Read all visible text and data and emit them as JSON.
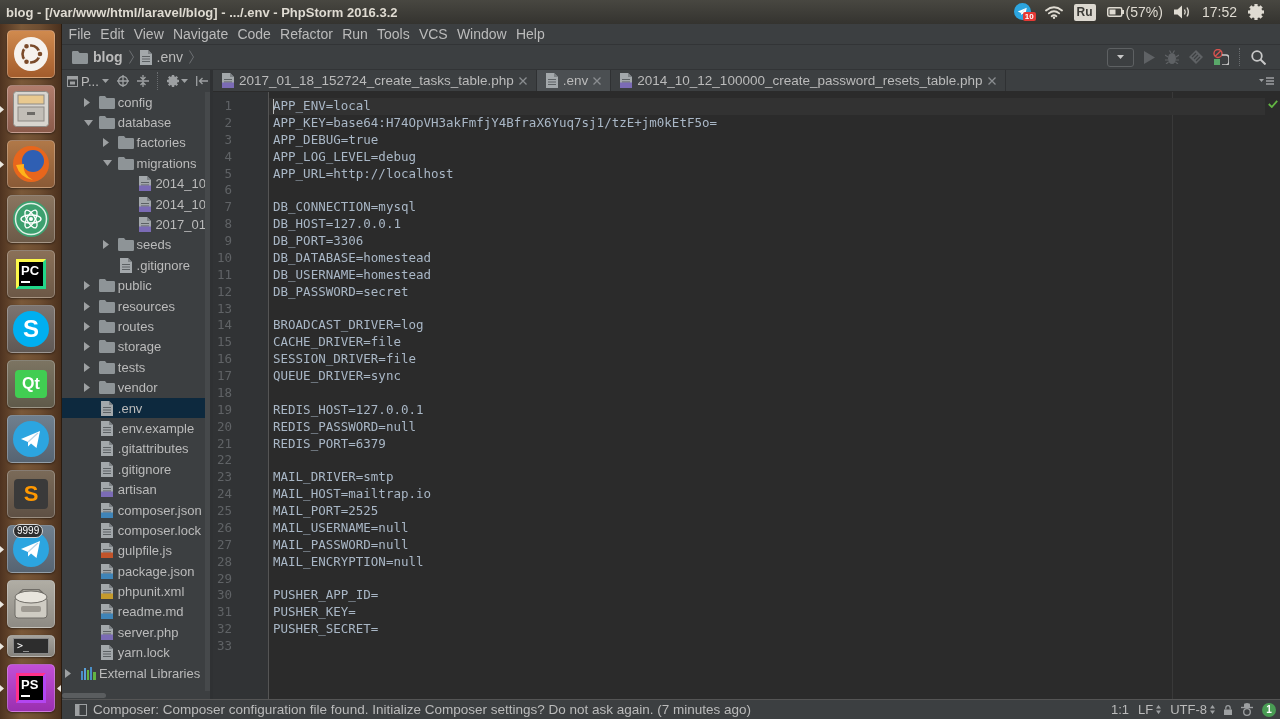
{
  "top_panel": {
    "title": "blog - [/var/www/html/laravel/blog] - .../.env - PhpStorm 2016.3.2",
    "notification_badge": "10",
    "keyboard_layout": "Ru",
    "battery": "(57%)",
    "clock": "17:52"
  },
  "launcher": {
    "items": [
      {
        "kind": "ubuntu",
        "running": false,
        "focused": false
      },
      {
        "kind": "files",
        "running": true,
        "focused": false
      },
      {
        "kind": "firefox",
        "running": true,
        "focused": false
      },
      {
        "kind": "atom",
        "running": false,
        "focused": false
      },
      {
        "kind": "pycharm",
        "glyph": "PC",
        "running": false,
        "focused": false
      },
      {
        "kind": "skype",
        "glyph": "S",
        "running": false,
        "focused": false
      },
      {
        "kind": "qt",
        "glyph": "Qt",
        "running": false,
        "focused": false
      },
      {
        "kind": "telegram",
        "running": false,
        "focused": false
      },
      {
        "kind": "sublime",
        "glyph": "S",
        "running": false,
        "focused": false
      },
      {
        "kind": "telegram",
        "badge": "9999",
        "running": true,
        "focused": false
      },
      {
        "kind": "scanner",
        "running": true,
        "focused": false
      },
      {
        "kind": "terminal",
        "glyph": ">_",
        "running": true,
        "focused": false
      },
      {
        "kind": "phpstorm",
        "glyph": "PS",
        "running": true,
        "focused": true
      }
    ]
  },
  "menu_bar": {
    "items": [
      "File",
      "Edit",
      "View",
      "Navigate",
      "Code",
      "Refactor",
      "Run",
      "Tools",
      "VCS",
      "Window",
      "Help"
    ]
  },
  "navigation_bar": {
    "crumbs": [
      {
        "kind": "folder",
        "label": "blog"
      },
      {
        "kind": "file",
        "label": ".env"
      }
    ]
  },
  "project_panel": {
    "title": "P...",
    "tree": [
      {
        "kind": "folder",
        "label": "config",
        "expanded": false,
        "selected": false
      },
      {
        "kind": "folder",
        "label": "database",
        "expanded": true,
        "selected": false,
        "children": [
          {
            "kind": "folder",
            "label": "factories",
            "expanded": false,
            "selected": false
          },
          {
            "kind": "folder",
            "label": "migrations",
            "expanded": true,
            "selected": false,
            "children": [
              {
                "kind": "php",
                "label": "2014_10",
                "selected": false
              },
              {
                "kind": "php",
                "label": "2014_10",
                "selected": false
              },
              {
                "kind": "php",
                "label": "2017_01",
                "selected": false
              }
            ]
          },
          {
            "kind": "folder",
            "label": "seeds",
            "expanded": false,
            "selected": false
          },
          {
            "kind": "text",
            "label": ".gitignore",
            "selected": false
          }
        ]
      },
      {
        "kind": "folder",
        "label": "public",
        "expanded": false,
        "selected": false
      },
      {
        "kind": "folder",
        "label": "resources",
        "expanded": false,
        "selected": false
      },
      {
        "kind": "folder",
        "label": "routes",
        "expanded": false,
        "selected": false
      },
      {
        "kind": "folder",
        "label": "storage",
        "expanded": false,
        "selected": false
      },
      {
        "kind": "folder",
        "label": "tests",
        "expanded": false,
        "selected": false
      },
      {
        "kind": "folder",
        "label": "vendor",
        "expanded": false,
        "selected": false
      },
      {
        "kind": "text",
        "label": ".env",
        "selected": true
      },
      {
        "kind": "text",
        "label": ".env.example",
        "selected": false
      },
      {
        "kind": "text",
        "label": ".gitattributes",
        "selected": false
      },
      {
        "kind": "text",
        "label": ".gitignore",
        "selected": false
      },
      {
        "kind": "php",
        "label": "artisan",
        "selected": false
      },
      {
        "kind": "json",
        "label": "composer.json",
        "selected": false
      },
      {
        "kind": "text",
        "label": "composer.lock",
        "selected": false
      },
      {
        "kind": "js",
        "label": "gulpfile.js",
        "selected": false
      },
      {
        "kind": "json",
        "label": "package.json",
        "selected": false
      },
      {
        "kind": "xml",
        "label": "phpunit.xml",
        "selected": false
      },
      {
        "kind": "md",
        "label": "readme.md",
        "selected": false
      },
      {
        "kind": "php",
        "label": "server.php",
        "selected": false
      },
      {
        "kind": "text",
        "label": "yarn.lock",
        "selected": false
      }
    ],
    "external_libraries": {
      "kind": "library",
      "label": "External Libraries",
      "expanded": false,
      "selected": false
    }
  },
  "editor": {
    "tabs": [
      {
        "kind": "php",
        "label": "2017_01_18_152724_create_tasks_table.php",
        "selected": false
      },
      {
        "kind": "text",
        "label": ".env",
        "selected": true
      },
      {
        "kind": "php",
        "label": "2014_10_12_100000_create_password_resets_table.php",
        "selected": false
      }
    ],
    "lines": [
      {
        "number": "1",
        "text": "APP_ENV=local",
        "current": true
      },
      {
        "number": "2",
        "text": "APP_KEY=base64:H74OpVH3akFmfjY4BfraX6Yuq7sj1/tzE+jm0kEtF5o=",
        "current": false
      },
      {
        "number": "3",
        "text": "APP_DEBUG=true",
        "current": false
      },
      {
        "number": "4",
        "text": "APP_LOG_LEVEL=debug",
        "current": false
      },
      {
        "number": "5",
        "text": "APP_URL=http://localhost",
        "current": false
      },
      {
        "number": "6",
        "current": false
      },
      {
        "number": "7",
        "text": "DB_CONNECTION=mysql",
        "current": false
      },
      {
        "number": "8",
        "text": "DB_HOST=127.0.0.1",
        "current": false
      },
      {
        "number": "9",
        "text": "DB_PORT=3306",
        "current": false
      },
      {
        "number": "10",
        "text": "DB_DATABASE=homestead",
        "current": false
      },
      {
        "number": "11",
        "text": "DB_USERNAME=homestead",
        "current": false
      },
      {
        "number": "12",
        "text": "DB_PASSWORD=secret",
        "current": false
      },
      {
        "number": "13",
        "current": false
      },
      {
        "number": "14",
        "text": "BROADCAST_DRIVER=log",
        "current": false
      },
      {
        "number": "15",
        "text": "CACHE_DRIVER=file",
        "current": false
      },
      {
        "number": "16",
        "text": "SESSION_DRIVER=file",
        "current": false
      },
      {
        "number": "17",
        "text": "QUEUE_DRIVER=sync",
        "current": false
      },
      {
        "number": "18",
        "current": false
      },
      {
        "number": "19",
        "text": "REDIS_HOST=127.0.0.1",
        "current": false
      },
      {
        "number": "20",
        "text": "REDIS_PASSWORD=null",
        "current": false
      },
      {
        "number": "21",
        "text": "REDIS_PORT=6379",
        "current": false
      },
      {
        "number": "22",
        "current": false
      },
      {
        "number": "23",
        "text": "MAIL_DRIVER=smtp",
        "current": false
      },
      {
        "number": "24",
        "text": "MAIL_HOST=mailtrap.io",
        "current": false
      },
      {
        "number": "25",
        "text": "MAIL_PORT=2525",
        "current": false
      },
      {
        "number": "26",
        "text": "MAIL_USERNAME=null",
        "current": false
      },
      {
        "number": "27",
        "text": "MAIL_PASSWORD=null",
        "current": false
      },
      {
        "number": "28",
        "text": "MAIL_ENCRYPTION=null",
        "current": false
      },
      {
        "number": "29",
        "current": false
      },
      {
        "number": "30",
        "text": "PUSHER_APP_ID=",
        "current": false
      },
      {
        "number": "31",
        "text": "PUSHER_KEY=",
        "current": false
      },
      {
        "number": "32",
        "text": "PUSHER_SECRET=",
        "current": false
      },
      {
        "number": "33",
        "current": false
      }
    ]
  },
  "status_bar": {
    "message": "Composer: Composer configuration file found. Initialize Composer settings? Do not ask again. (7 minutes ago)",
    "position": "1:1",
    "line_separator": "LF",
    "encoding": "UTF-8",
    "event_count": "1"
  }
}
